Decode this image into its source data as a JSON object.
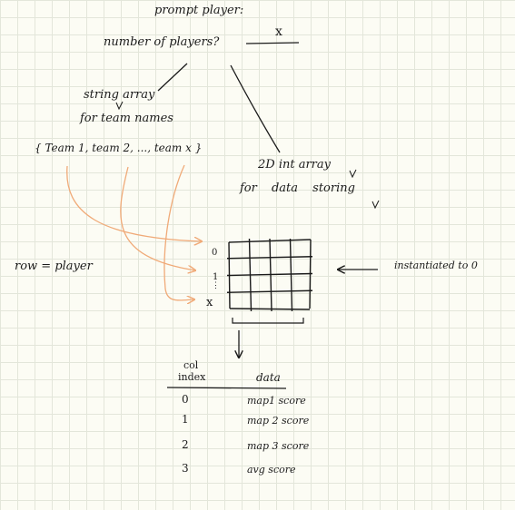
{
  "prompt": {
    "title": "prompt player:",
    "question": "number of players?",
    "answer": "x"
  },
  "string_array": {
    "line1": "string array",
    "line2": "for team names",
    "contents": "{ Team 1, team 2, ..., team x }"
  },
  "int_array": {
    "line1": "2D int array",
    "line2": "for data storing"
  },
  "grid": {
    "row_label": "row = player",
    "row_index_first": "0",
    "row_index_mid": "1",
    "row_index_ellipsis": "⋮",
    "row_index_last": "x",
    "init_note": "instantiated to 0",
    "row_count": 4,
    "col_count": 4
  },
  "legend": {
    "col_header_line1": "col",
    "col_header_line2": "index",
    "data_header": "data",
    "rows": [
      {
        "index": "0",
        "data": "map1 score"
      },
      {
        "index": "1",
        "data": "map 2 score"
      },
      {
        "index": "2",
        "data": "map 3 score"
      },
      {
        "index": "3",
        "data": "avg score"
      }
    ]
  },
  "colors": {
    "ink": "#1b1b1b",
    "orange": "#f0aa78",
    "paper": "#fcfcf4",
    "grid_line": "#e3e6da"
  }
}
